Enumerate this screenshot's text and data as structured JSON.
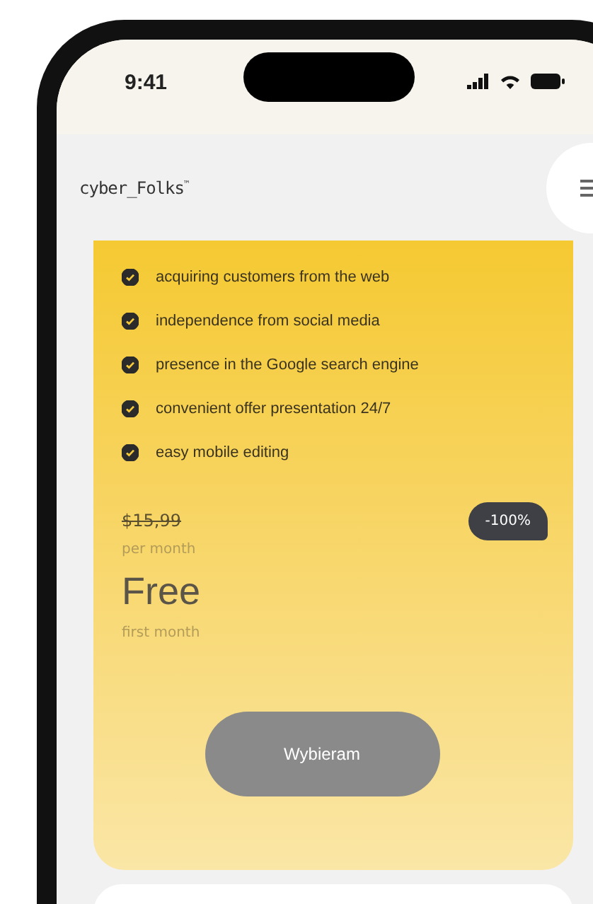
{
  "status_bar": {
    "time": "9:41"
  },
  "header": {
    "logo": "cyber_Folks",
    "logo_mark": "™"
  },
  "plan": {
    "features": [
      {
        "text": "acquiring customers from the web",
        "checked": true
      },
      {
        "text": "independence from social media",
        "checked": true
      },
      {
        "text": "presence in the Google search engine",
        "checked": true
      },
      {
        "text": "convenient offer presentation 24/7",
        "checked": true
      },
      {
        "text": "easy mobile editing",
        "checked": true
      }
    ],
    "old_price": "$15,99",
    "old_period": "per month",
    "discount": "-100%",
    "price": "Free",
    "price_period": "first month",
    "button": "Wybieram"
  }
}
